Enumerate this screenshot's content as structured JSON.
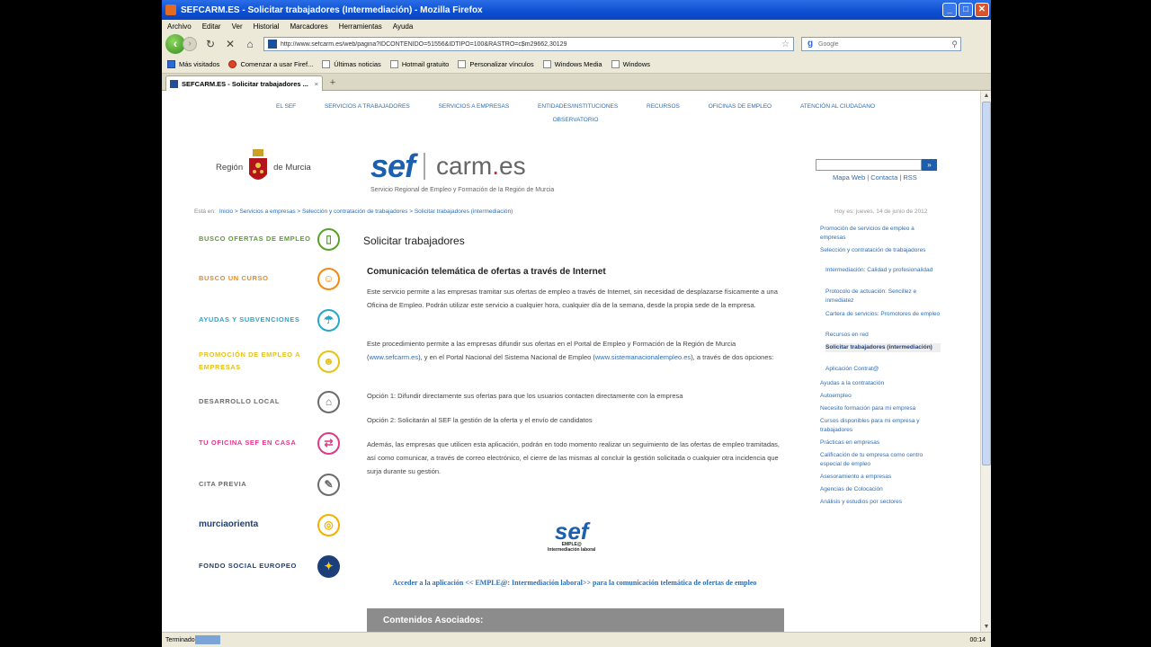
{
  "window": {
    "title": "SEFCARM.ES - Solicitar trabajadores (Intermediación) - Mozilla Firefox",
    "buttons": {
      "minimize": "_",
      "maximize": "□",
      "close": "✕"
    }
  },
  "menubar": [
    "Archivo",
    "Editar",
    "Ver",
    "Historial",
    "Marcadores",
    "Herramientas",
    "Ayuda"
  ],
  "navbar": {
    "url": "http://www.sefcarm.es/web/pagina?IDCONTENIDO=51556&IDTIPO=100&RASTRO=c$m29662,30129",
    "search_placeholder": "Google"
  },
  "bookmarks": [
    "Más visitados",
    "Comenzar a usar Firef...",
    "Últimas noticias",
    "Hotmail gratuito",
    "Personalizar vínculos",
    "Windows Media",
    "Windows"
  ],
  "tab": {
    "label": "SEFCARM.ES - Solicitar trabajadores ...",
    "close": "×",
    "new": "+"
  },
  "site": {
    "topnav": [
      "EL SEF",
      "SERVICIOS A TRABAJADORES",
      "SERVICIOS A EMPRESAS",
      "ENTIDADES/INSTITUCIONES",
      "RECURSOS",
      "OFICINAS DE EMPLEO",
      "ATENCIÓN AL CIUDADANO",
      "OBSERVATORIO"
    ],
    "region_left": "Región",
    "region_right": "de Murcia",
    "logo_sef": "sef",
    "logo_carm": "carm",
    "logo_dot": ".",
    "logo_es": "es",
    "logo_sub": "Servicio Regional de Empleo y Formación de la Región de Murcia",
    "search_btn": "»",
    "links": "Mapa Web | Contacta | RSS",
    "crumb_label": "Está en:",
    "crumbs": "Inicio > Servicios a empresas > Selección y contratación de trabajadores > Solicitar trabajadores (intermediación)",
    "date": "Hoy es: jueves, 14 de junio de 2012"
  },
  "left_menu": [
    {
      "label": "BUSCO OFERTAS DE EMPLEO",
      "color": "#5aa12b",
      "icon": "▯"
    },
    {
      "label": "BUSCO UN CURSO",
      "color": "#f08a16",
      "icon": "☺"
    },
    {
      "label": "AYUDAS Y SUBVENCIONES",
      "color": "#2aa6c9",
      "icon": "☂"
    },
    {
      "label": "PROMOCIÓN DE EMPLEO A EMPRESAS",
      "color": "#e5c21a",
      "icon": "☻"
    },
    {
      "label": "DESARROLLO LOCAL",
      "color": "#6b6b6b",
      "icon": "⌂"
    },
    {
      "label": "TU OFICINA SEF EN CASA",
      "color": "#e2378a",
      "icon": "⇄"
    },
    {
      "label": "CITA PREVIA",
      "color": "#6b6b6b",
      "icon": "✎"
    },
    {
      "label": "murciaorienta",
      "color": "#1c3f7a",
      "icon": "◎"
    },
    {
      "label": "FONDO SOCIAL EUROPEO",
      "color": "#1c3f7a",
      "icon": "✦"
    }
  ],
  "main": {
    "title": "Solicitar trabajadores",
    "subtitle": "Comunicación telemática de ofertas a través de Internet",
    "p1": "Este servicio permite a las empresas tramitar sus ofertas de empleo a través de Internet, sin necesidad de desplazarse físicamente a una Oficina de Empleo. Podrán utilizar este servicio a cualquier hora, cualquier día de la semana, desde la propia sede de la empresa.",
    "p2a": "Este procedimiento permite a las empresas difundir sus ofertas en el Portal de Empleo y Formación de la Región de Murcia (",
    "p2link1": "www.sefcarm.es",
    "p2b": "), y en el Portal Nacional del Sistema Nacional de Empleo (",
    "p2link2": "www.sistemanacionalempleo.es",
    "p2c": "), a través de dos opciones:",
    "opt1": "Opción 1: Difundir directamente sus ofertas para que los usuarios contacten directamente con la empresa",
    "opt2": "Opción 2: Solicitarán al SEF la gestión de la oferta y el envío de candidatos",
    "p3": "Además, las empresas que utilicen esta aplicación, podrán en todo momento realizar un seguimiento de las ofertas de empleo tramitadas, así como comunicar, a través de correo electrónico, el cierre de las mismas al concluir la gestión solicitada o cualquier otra incidencia que surja durante su gestión.",
    "logo_sef": "sef",
    "logo_sub1": "EMPLE@",
    "logo_sub2": "Intermediación laboral",
    "app_link": "Acceder a la aplicación << EMPLE@: Intermediación laboral>> para la comunicación telemática de ofertas de empleo",
    "related": "Contenidos Asociados:"
  },
  "right_menu": [
    {
      "label": "Promoción de servicios de empleo a empresas",
      "sub": false,
      "active": false
    },
    {
      "label": "Selección y contratación de trabajadores",
      "sub": false,
      "active": false
    },
    {
      "label": "Intermediación: Calidad y profesionalidad",
      "sub": true,
      "active": false
    },
    {
      "label": "Protocolo de actuación: Sencillez e inmediatez",
      "sub": true,
      "active": false
    },
    {
      "label": "Cartera de servicios: Promotores de empleo",
      "sub": true,
      "active": false
    },
    {
      "label": "Recursos en red",
      "sub": true,
      "active": false
    },
    {
      "label": "Solicitar trabajadores (intermediación)",
      "sub": true,
      "active": true
    },
    {
      "label": "Aplicación Contrat@",
      "sub": true,
      "active": false
    },
    {
      "label": "Ayudas a la contratación",
      "sub": false,
      "active": false
    },
    {
      "label": "Autoempleo",
      "sub": false,
      "active": false
    },
    {
      "label": "Necesito formación para mi empresa",
      "sub": false,
      "active": false
    },
    {
      "label": "Cursos disponibles para mi empresa y trabajadores",
      "sub": false,
      "active": false
    },
    {
      "label": "Prácticas en empresas",
      "sub": false,
      "active": false
    },
    {
      "label": "Calificación de tu empresa como centro especial de empleo",
      "sub": false,
      "active": false
    },
    {
      "label": "Asesoramiento a empresas",
      "sub": false,
      "active": false
    },
    {
      "label": "Agencias de Colocación",
      "sub": false,
      "active": false
    },
    {
      "label": "Análisis y estudios por sectores",
      "sub": false,
      "active": false
    }
  ],
  "status": {
    "text": "Terminado",
    "clock": "00:14"
  }
}
